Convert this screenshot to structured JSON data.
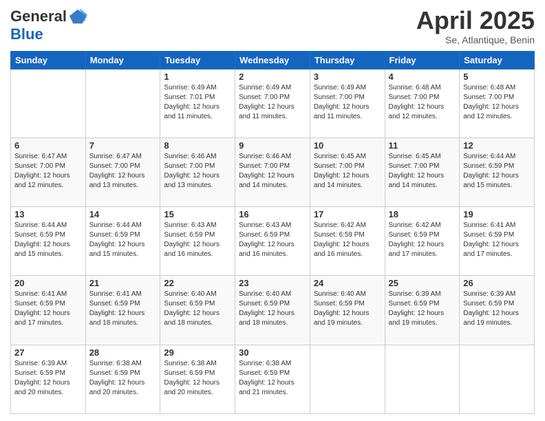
{
  "header": {
    "logo_general": "General",
    "logo_blue": "Blue",
    "month_title": "April 2025",
    "location": "Se, Atlantique, Benin"
  },
  "days_of_week": [
    "Sunday",
    "Monday",
    "Tuesday",
    "Wednesday",
    "Thursday",
    "Friday",
    "Saturday"
  ],
  "weeks": [
    [
      {
        "day": "",
        "info": ""
      },
      {
        "day": "",
        "info": ""
      },
      {
        "day": "1",
        "info": "Sunrise: 6:49 AM\nSunset: 7:01 PM\nDaylight: 12 hours\nand 11 minutes."
      },
      {
        "day": "2",
        "info": "Sunrise: 6:49 AM\nSunset: 7:00 PM\nDaylight: 12 hours\nand 11 minutes."
      },
      {
        "day": "3",
        "info": "Sunrise: 6:49 AM\nSunset: 7:00 PM\nDaylight: 12 hours\nand 11 minutes."
      },
      {
        "day": "4",
        "info": "Sunrise: 6:48 AM\nSunset: 7:00 PM\nDaylight: 12 hours\nand 12 minutes."
      },
      {
        "day": "5",
        "info": "Sunrise: 6:48 AM\nSunset: 7:00 PM\nDaylight: 12 hours\nand 12 minutes."
      }
    ],
    [
      {
        "day": "6",
        "info": "Sunrise: 6:47 AM\nSunset: 7:00 PM\nDaylight: 12 hours\nand 12 minutes."
      },
      {
        "day": "7",
        "info": "Sunrise: 6:47 AM\nSunset: 7:00 PM\nDaylight: 12 hours\nand 13 minutes."
      },
      {
        "day": "8",
        "info": "Sunrise: 6:46 AM\nSunset: 7:00 PM\nDaylight: 12 hours\nand 13 minutes."
      },
      {
        "day": "9",
        "info": "Sunrise: 6:46 AM\nSunset: 7:00 PM\nDaylight: 12 hours\nand 14 minutes."
      },
      {
        "day": "10",
        "info": "Sunrise: 6:45 AM\nSunset: 7:00 PM\nDaylight: 12 hours\nand 14 minutes."
      },
      {
        "day": "11",
        "info": "Sunrise: 6:45 AM\nSunset: 7:00 PM\nDaylight: 12 hours\nand 14 minutes."
      },
      {
        "day": "12",
        "info": "Sunrise: 6:44 AM\nSunset: 6:59 PM\nDaylight: 12 hours\nand 15 minutes."
      }
    ],
    [
      {
        "day": "13",
        "info": "Sunrise: 6:44 AM\nSunset: 6:59 PM\nDaylight: 12 hours\nand 15 minutes."
      },
      {
        "day": "14",
        "info": "Sunrise: 6:44 AM\nSunset: 6:59 PM\nDaylight: 12 hours\nand 15 minutes."
      },
      {
        "day": "15",
        "info": "Sunrise: 6:43 AM\nSunset: 6:59 PM\nDaylight: 12 hours\nand 16 minutes."
      },
      {
        "day": "16",
        "info": "Sunrise: 6:43 AM\nSunset: 6:59 PM\nDaylight: 12 hours\nand 16 minutes."
      },
      {
        "day": "17",
        "info": "Sunrise: 6:42 AM\nSunset: 6:59 PM\nDaylight: 12 hours\nand 16 minutes."
      },
      {
        "day": "18",
        "info": "Sunrise: 6:42 AM\nSunset: 6:59 PM\nDaylight: 12 hours\nand 17 minutes."
      },
      {
        "day": "19",
        "info": "Sunrise: 6:41 AM\nSunset: 6:59 PM\nDaylight: 12 hours\nand 17 minutes."
      }
    ],
    [
      {
        "day": "20",
        "info": "Sunrise: 6:41 AM\nSunset: 6:59 PM\nDaylight: 12 hours\nand 17 minutes."
      },
      {
        "day": "21",
        "info": "Sunrise: 6:41 AM\nSunset: 6:59 PM\nDaylight: 12 hours\nand 18 minutes."
      },
      {
        "day": "22",
        "info": "Sunrise: 6:40 AM\nSunset: 6:59 PM\nDaylight: 12 hours\nand 18 minutes."
      },
      {
        "day": "23",
        "info": "Sunrise: 6:40 AM\nSunset: 6:59 PM\nDaylight: 12 hours\nand 18 minutes."
      },
      {
        "day": "24",
        "info": "Sunrise: 6:40 AM\nSunset: 6:59 PM\nDaylight: 12 hours\nand 19 minutes."
      },
      {
        "day": "25",
        "info": "Sunrise: 6:39 AM\nSunset: 6:59 PM\nDaylight: 12 hours\nand 19 minutes."
      },
      {
        "day": "26",
        "info": "Sunrise: 6:39 AM\nSunset: 6:59 PM\nDaylight: 12 hours\nand 19 minutes."
      }
    ],
    [
      {
        "day": "27",
        "info": "Sunrise: 6:39 AM\nSunset: 6:59 PM\nDaylight: 12 hours\nand 20 minutes."
      },
      {
        "day": "28",
        "info": "Sunrise: 6:38 AM\nSunset: 6:59 PM\nDaylight: 12 hours\nand 20 minutes."
      },
      {
        "day": "29",
        "info": "Sunrise: 6:38 AM\nSunset: 6:59 PM\nDaylight: 12 hours\nand 20 minutes."
      },
      {
        "day": "30",
        "info": "Sunrise: 6:38 AM\nSunset: 6:59 PM\nDaylight: 12 hours\nand 21 minutes."
      },
      {
        "day": "",
        "info": ""
      },
      {
        "day": "",
        "info": ""
      },
      {
        "day": "",
        "info": ""
      }
    ]
  ]
}
